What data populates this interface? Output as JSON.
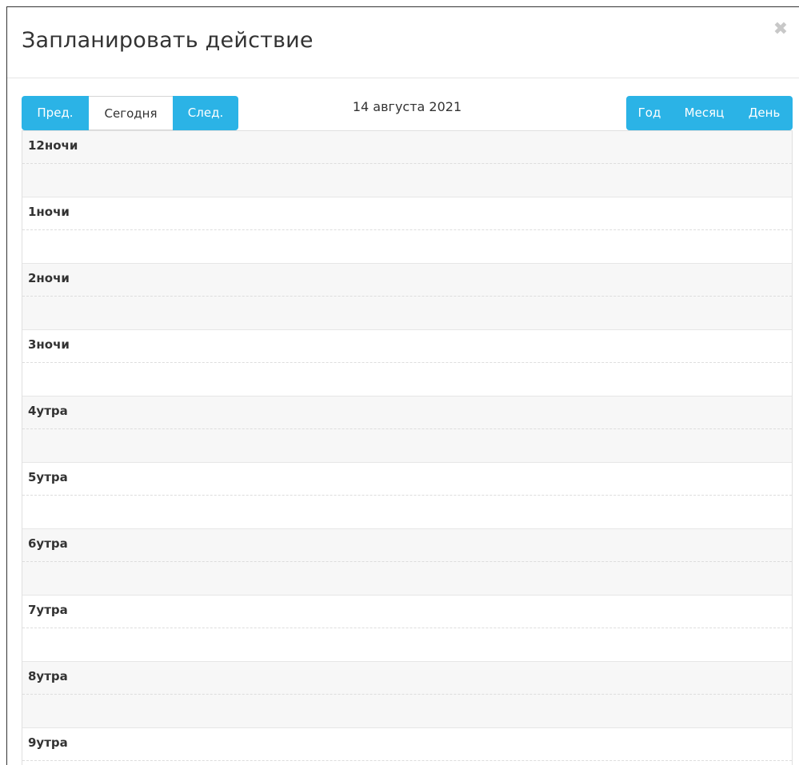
{
  "modal": {
    "title": "Запланировать действие",
    "close_icon": "close-icon"
  },
  "toolbar": {
    "prev_label": "Пред.",
    "today_label": "Сегодня",
    "next_label": "След.",
    "date_title": "14 августа 2021",
    "year_label": "Год",
    "month_label": "Месяц",
    "day_label": "День",
    "active_view": "День"
  },
  "calendar": {
    "hours": [
      "12ночи",
      "1ночи",
      "2ночи",
      "3ночи",
      "4утра",
      "5утра",
      "6утра",
      "7утра",
      "8утра",
      "9утра"
    ]
  },
  "colors": {
    "accent": "#2bb3e6",
    "shaded_row": "#f7f7f7",
    "text": "#333333"
  }
}
